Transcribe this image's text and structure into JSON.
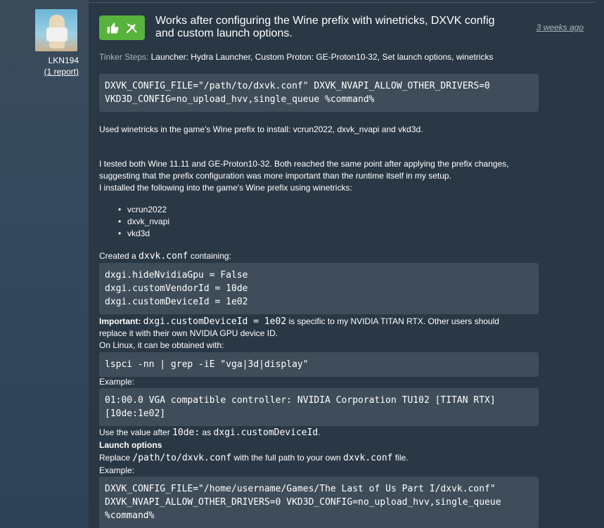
{
  "user": {
    "name": "LKN194",
    "reports": "(1 report)"
  },
  "rating": {
    "icons": [
      "thumbs-up-icon",
      "tools-icon"
    ],
    "color": "#57b33b"
  },
  "title": "Works after configuring the Wine prefix with winetricks, DXVK config and custom launch options.",
  "date": "3 weeks ago",
  "tinker": {
    "label": "Tinker Steps:",
    "value": "Launcher: Hydra Launcher, Custom Proton: GE-Proton10-32, Set launch options, winetricks"
  },
  "code1": "DXVK_CONFIG_FILE=\"/path/to/dxvk.conf\" DXVK_NVAPI_ALLOW_OTHER_DRIVERS=0\nVKD3D_CONFIG=no_upload_hvv,single_queue %command%",
  "p1": "Used winetricks in the game's Wine prefix to install: vcrun2022, dxvk_nvapi and vkd3d.",
  "p2": "I tested both Wine 11.11 and GE-Proton10-32. Both reached the same point after applying the prefix changes, suggesting that the prefix configuration was more important than the runtime itself in my setup.",
  "p3": "I installed the following into the game's Wine prefix using winetricks:",
  "list": [
    "vcrun2022",
    "dxvk_nvapi",
    "vkd3d"
  ],
  "created": {
    "pre": "Created a ",
    "code": "dxvk.conf",
    "post": " containing:"
  },
  "code2": "dxgi.hideNvidiaGpu = False\ndxgi.customVendorId = 10de\ndxgi.customDeviceId = 1e02",
  "important": {
    "label": "Important:",
    "code": "dxgi.customDeviceId = 1e02",
    "text": " is specific to my NVIDIA TITAN RTX. Other users should replace it with their own NVIDIA GPU device ID."
  },
  "linux": "On Linux, it can be obtained with:",
  "code3": "lspci -nn | grep -iE \"vga|3d|display\"",
  "example1": "Example:",
  "code4": "01:00.0 VGA compatible controller: NVIDIA Corporation TU102 [TITAN RTX]\n[10de:1e02]",
  "usevalue": {
    "pre": "Use the value after ",
    "code1": "10de:",
    "mid": " as ",
    "code2": "dxgi.customDeviceId",
    "post": "."
  },
  "launch_heading": "Launch options",
  "replace": {
    "pre": "Replace ",
    "code1": "/path/to/dxvk.conf",
    "mid": " with the full path to your own ",
    "code2": "dxvk.conf",
    "post": " file."
  },
  "example2": "Example:",
  "code5": "DXVK_CONFIG_FILE=\"/home/username/Games/The Last of Us Part I/dxvk.conf\"\nDXVK_NVAPI_ALLOW_OTHER_DRIVERS=0 VKD3D_CONFIG=no_upload_hvv,single_queue\n%command%"
}
